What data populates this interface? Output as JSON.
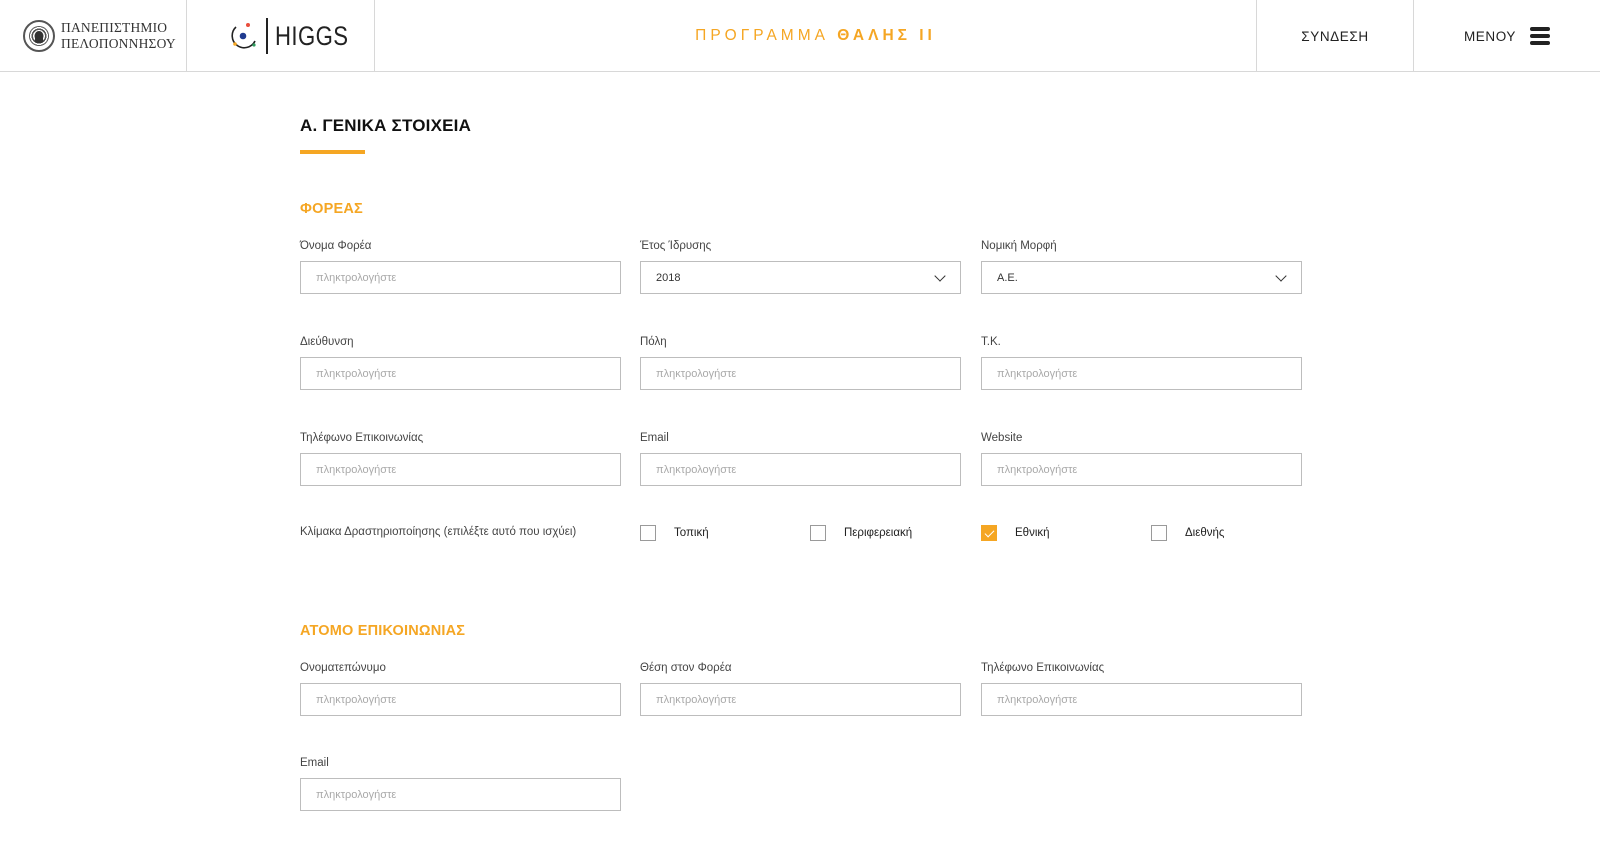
{
  "header": {
    "university": {
      "line1": "ΠΑΝΕΠΙΣΤΗΜΙΟ",
      "line2": "ΠΕΛΟΠΟΝΝΗΣΟΥ"
    },
    "brand": "HIGGS",
    "program": {
      "prefix": "ΠΡΟΓΡΑΜΜΑ",
      "name": "ΘΑΛΗΣ ΙΙ"
    },
    "login": "ΣΥΝΔΕΣΗ",
    "menu": "ΜΕΝΟΥ"
  },
  "section": {
    "title": "Α. ΓΕΝΙΚΑ ΣΤΟΙΧΕΙΑ"
  },
  "organization": {
    "title": "ΦΟΡΕΑΣ",
    "name": {
      "label": "Όνομα Φορέα",
      "placeholder": "πληκτρολογήστε"
    },
    "founded": {
      "label": "Έτος Ίδρυσης",
      "value": "2018"
    },
    "legal_form": {
      "label": "Νομική Μορφή",
      "value": "Α.Ε."
    },
    "address": {
      "label": "Διεύθυνση",
      "placeholder": "πληκτρολογήστε"
    },
    "city": {
      "label": "Πόλη",
      "placeholder": "πληκτρολογήστε"
    },
    "postal_code": {
      "label": "Τ.Κ.",
      "placeholder": "πληκτρολογήστε"
    },
    "phone": {
      "label": "Τηλέφωνο Επικοινωνίας",
      "placeholder": "πληκτρολογήστε"
    },
    "email": {
      "label": "Email",
      "placeholder": "πληκτρολογήστε"
    },
    "website": {
      "label": "Website",
      "placeholder": "πληκτρολογήστε"
    },
    "scale": {
      "label": "Κλίμακα Δραστηριοποίησης (επιλέξτε αυτό που ισχύει)",
      "options": [
        {
          "label": "Τοπική",
          "checked": false
        },
        {
          "label": "Περιφερειακή",
          "checked": false
        },
        {
          "label": "Εθνική",
          "checked": true
        },
        {
          "label": "Διεθνής",
          "checked": false
        }
      ]
    }
  },
  "contact": {
    "title": "ΑΤΟΜΟ ΕΠΙΚΟΙΝΩΝΙΑΣ",
    "full_name": {
      "label": "Ονοματεπώνυμο",
      "placeholder": "πληκτρολογήστε"
    },
    "position": {
      "label": "Θέση στον Φορέα",
      "placeholder": "πληκτρολογήστε"
    },
    "phone": {
      "label": "Τηλέφωνο Επικοινωνίας",
      "placeholder": "πληκτρολογήστε"
    },
    "email": {
      "label": "Email",
      "placeholder": "πληκτρολογήστε"
    }
  },
  "colors": {
    "accent": "#f5a623",
    "border": "#bdbdbd",
    "text": "#222222"
  }
}
